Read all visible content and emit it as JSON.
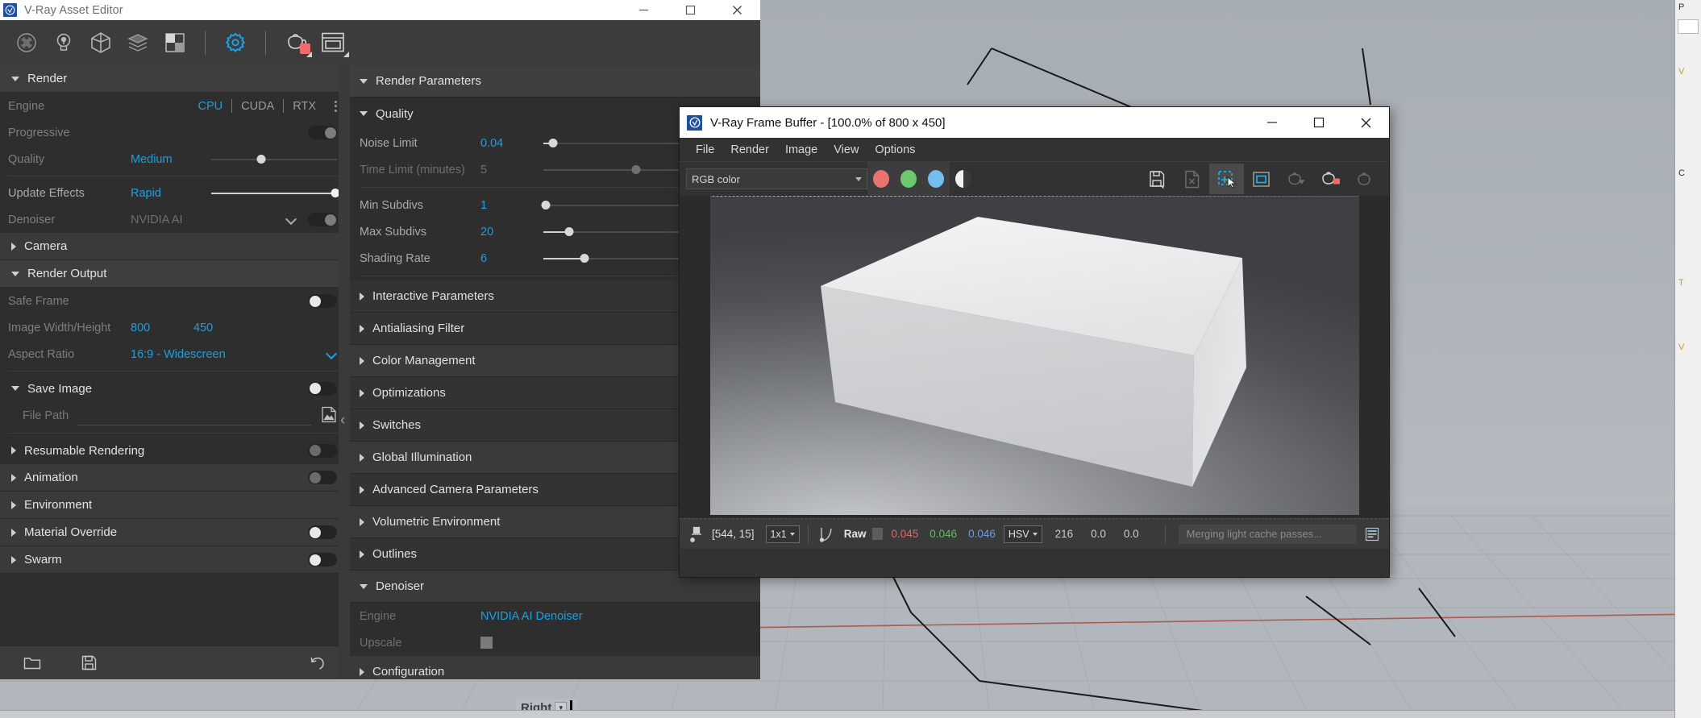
{
  "asset_editor": {
    "title": "V-Ray Asset Editor",
    "logo_icon": "vray-logo-icon",
    "window_buttons": [
      {
        "name": "minimize-button",
        "glyph": "minimize-icon"
      },
      {
        "name": "maximize-button",
        "glyph": "maximize-icon"
      },
      {
        "name": "close-button",
        "glyph": "close-icon"
      }
    ],
    "toolbar": [
      {
        "name": "materials-icon",
        "label": "Materials"
      },
      {
        "name": "lights-icon",
        "label": "Lights"
      },
      {
        "name": "geometry-icon",
        "label": "Geometry"
      },
      {
        "name": "textures-icon",
        "label": "Textures"
      },
      {
        "name": "render-elements-icon",
        "label": "Render Elements"
      },
      {
        "name": "settings-gear-icon",
        "label": "Settings",
        "active": true
      },
      {
        "name": "render-teapot-icon",
        "label": "Render"
      },
      {
        "name": "frame-buffer-icon",
        "label": "Show Frame Buffer"
      }
    ],
    "footer": [
      {
        "name": "open-scene-icon",
        "label": "Load Asset"
      },
      {
        "name": "save-scene-icon",
        "label": "Save Asset"
      },
      {
        "name": "revert-icon",
        "label": "Revert to Defaults"
      }
    ],
    "left_panel": {
      "render_section": {
        "title": "Render",
        "expanded": true,
        "engine": {
          "label": "Engine",
          "options": [
            "CPU",
            "CUDA",
            "RTX"
          ],
          "selected": "CPU",
          "kebab_icon": "more-options-icon"
        },
        "progressive": {
          "label": "Progressive",
          "toggle": "on"
        },
        "quality": {
          "label": "Quality",
          "value": "Medium",
          "slider_pct": 40
        },
        "update_effects": {
          "label": "Update Effects",
          "value": "Rapid",
          "slider_pct": 100
        },
        "denoiser": {
          "label": "Denoiser",
          "value": "NVIDIA AI",
          "chevron_icon": "chevron-down-icon",
          "toggle": "on"
        }
      },
      "camera_section": {
        "title": "Camera",
        "expanded": false
      },
      "render_output_section": {
        "title": "Render Output",
        "expanded": true,
        "safe_frame": {
          "label": "Safe Frame",
          "toggle": "off"
        },
        "image_size": {
          "label": "Image Width/Height",
          "width": "800",
          "height": "450"
        },
        "aspect_ratio": {
          "label": "Aspect Ratio",
          "value": "16:9 - Widescreen",
          "chevron_icon": "chevron-down-icon"
        }
      },
      "save_image_section": {
        "title": "Save Image",
        "expanded": true,
        "toggle": "off",
        "file_path": {
          "label": "File Path",
          "placeholder": "File Path",
          "value": "",
          "browse_icon": "image-file-icon"
        }
      },
      "other_sections": [
        {
          "title": "Resumable Rendering",
          "expanded": false,
          "toggle": "off-dim"
        },
        {
          "title": "Animation",
          "expanded": false,
          "toggle": "off-dim",
          "alt": true
        },
        {
          "title": "Environment",
          "expanded": false,
          "toggle": null,
          "alt": true
        },
        {
          "title": "Material Override",
          "expanded": false,
          "toggle": "off",
          "alt": true
        },
        {
          "title": "Swarm",
          "expanded": false,
          "toggle": "off",
          "alt": true
        }
      ],
      "collapse_handle_icon": "chevron-left-icon"
    },
    "mid_panel": {
      "header": {
        "title": "Render Parameters",
        "expanded": true
      },
      "quality": {
        "title": "Quality",
        "expanded": true,
        "rows": [
          {
            "label": "Noise Limit",
            "value": "0.04",
            "slider_pct": 6,
            "dim": false
          },
          {
            "label": "Time Limit (minutes)",
            "value": "5",
            "slider_pct": 68,
            "dim": true
          }
        ],
        "rows2": [
          {
            "label": "Min Subdivs",
            "value": "1",
            "slider_pct": 2,
            "dim": false
          },
          {
            "label": "Max Subdivs",
            "value": "20",
            "slider_pct": 19,
            "dim": false
          },
          {
            "label": "Shading Rate",
            "value": "6",
            "slider_pct": 30,
            "dim": false
          }
        ]
      },
      "sections": [
        {
          "title": "Interactive Parameters",
          "expanded": false,
          "alt": false
        },
        {
          "title": "Antialiasing Filter",
          "expanded": false,
          "alt": false
        },
        {
          "title": "Color Management",
          "expanded": false,
          "alt": true
        },
        {
          "title": "Optimizations",
          "expanded": false,
          "alt": false
        },
        {
          "title": "Switches",
          "expanded": false,
          "alt": false
        },
        {
          "title": "Global Illumination",
          "expanded": false,
          "alt": true
        },
        {
          "title": "Advanced Camera Parameters",
          "expanded": false,
          "alt": false
        },
        {
          "title": "Volumetric Environment",
          "expanded": false,
          "alt": true
        },
        {
          "title": "Outlines",
          "expanded": false,
          "alt": false
        }
      ],
      "denoiser": {
        "title": "Denoiser",
        "expanded": true,
        "engine": {
          "label": "Engine",
          "value": "NVIDIA AI Denoiser"
        },
        "upscale": {
          "label": "Upscale",
          "checked": false
        }
      },
      "configuration": {
        "title": "Configuration",
        "expanded": false
      }
    }
  },
  "frame_buffer": {
    "title": "V-Ray Frame Buffer - [100.0% of 800 x 450]",
    "logo_icon": "vray-logo-icon",
    "window_buttons": [
      {
        "name": "minimize-button",
        "glyph": "minimize-icon"
      },
      {
        "name": "maximize-button",
        "glyph": "maximize-icon"
      },
      {
        "name": "close-button",
        "glyph": "close-icon"
      }
    ],
    "menus": [
      "File",
      "Render",
      "Image",
      "View",
      "Options"
    ],
    "channel_combo": {
      "value": "RGB color",
      "caret_icon": "chevron-down-icon"
    },
    "channel_buttons": [
      {
        "name": "red-channel-button",
        "color": "#e8736f"
      },
      {
        "name": "green-channel-button",
        "color": "#6dc96d"
      },
      {
        "name": "blue-channel-button",
        "color": "#74bdee"
      },
      {
        "name": "alpha-channel-button",
        "color": "#ffffff"
      }
    ],
    "tools": [
      {
        "name": "save-image-icon",
        "state": "normal"
      },
      {
        "name": "export-image-icon",
        "state": "dim"
      },
      {
        "name": "region-render-icon",
        "state": "selected"
      },
      {
        "name": "follow-mouse-icon",
        "state": "normal"
      },
      {
        "name": "continue-render-icon",
        "state": "dim"
      },
      {
        "name": "render-last-icon",
        "state": "normal"
      },
      {
        "name": "abort-render-icon",
        "state": "dim"
      }
    ],
    "status_bar": {
      "pixel_icon": "pixel-probe-icon",
      "coordinates": "[544, 15]",
      "zoom_mode": "1x1",
      "curve_icon": "color-curve-icon",
      "mode_label": "Raw",
      "swatch_color": "#5d5d5d",
      "r": "0.045",
      "g": "0.046",
      "b": "0.046",
      "color_space": "HSV",
      "hsv": [
        "216",
        "0.0",
        "0.0"
      ],
      "message": "Merging light cache passes...",
      "log_icon": "render-log-icon"
    },
    "render_preview": {
      "description": "white box on grey gradient backdrop",
      "resolution": "800 x 450"
    }
  },
  "rhino": {
    "viewport_tab": {
      "label": "Right",
      "caret_icon": "chevron-down-icon"
    },
    "right_panel_rows": [
      "P",
      "V",
      "C",
      "T",
      "V"
    ]
  },
  "colors": {
    "accent_blue": "#1e9fe0",
    "panel_dark": "#2e2e2e",
    "panel_mid": "#3c3c3c",
    "vray_logo": "#1f4e9c",
    "viewport_grey": "#a9afb6"
  }
}
